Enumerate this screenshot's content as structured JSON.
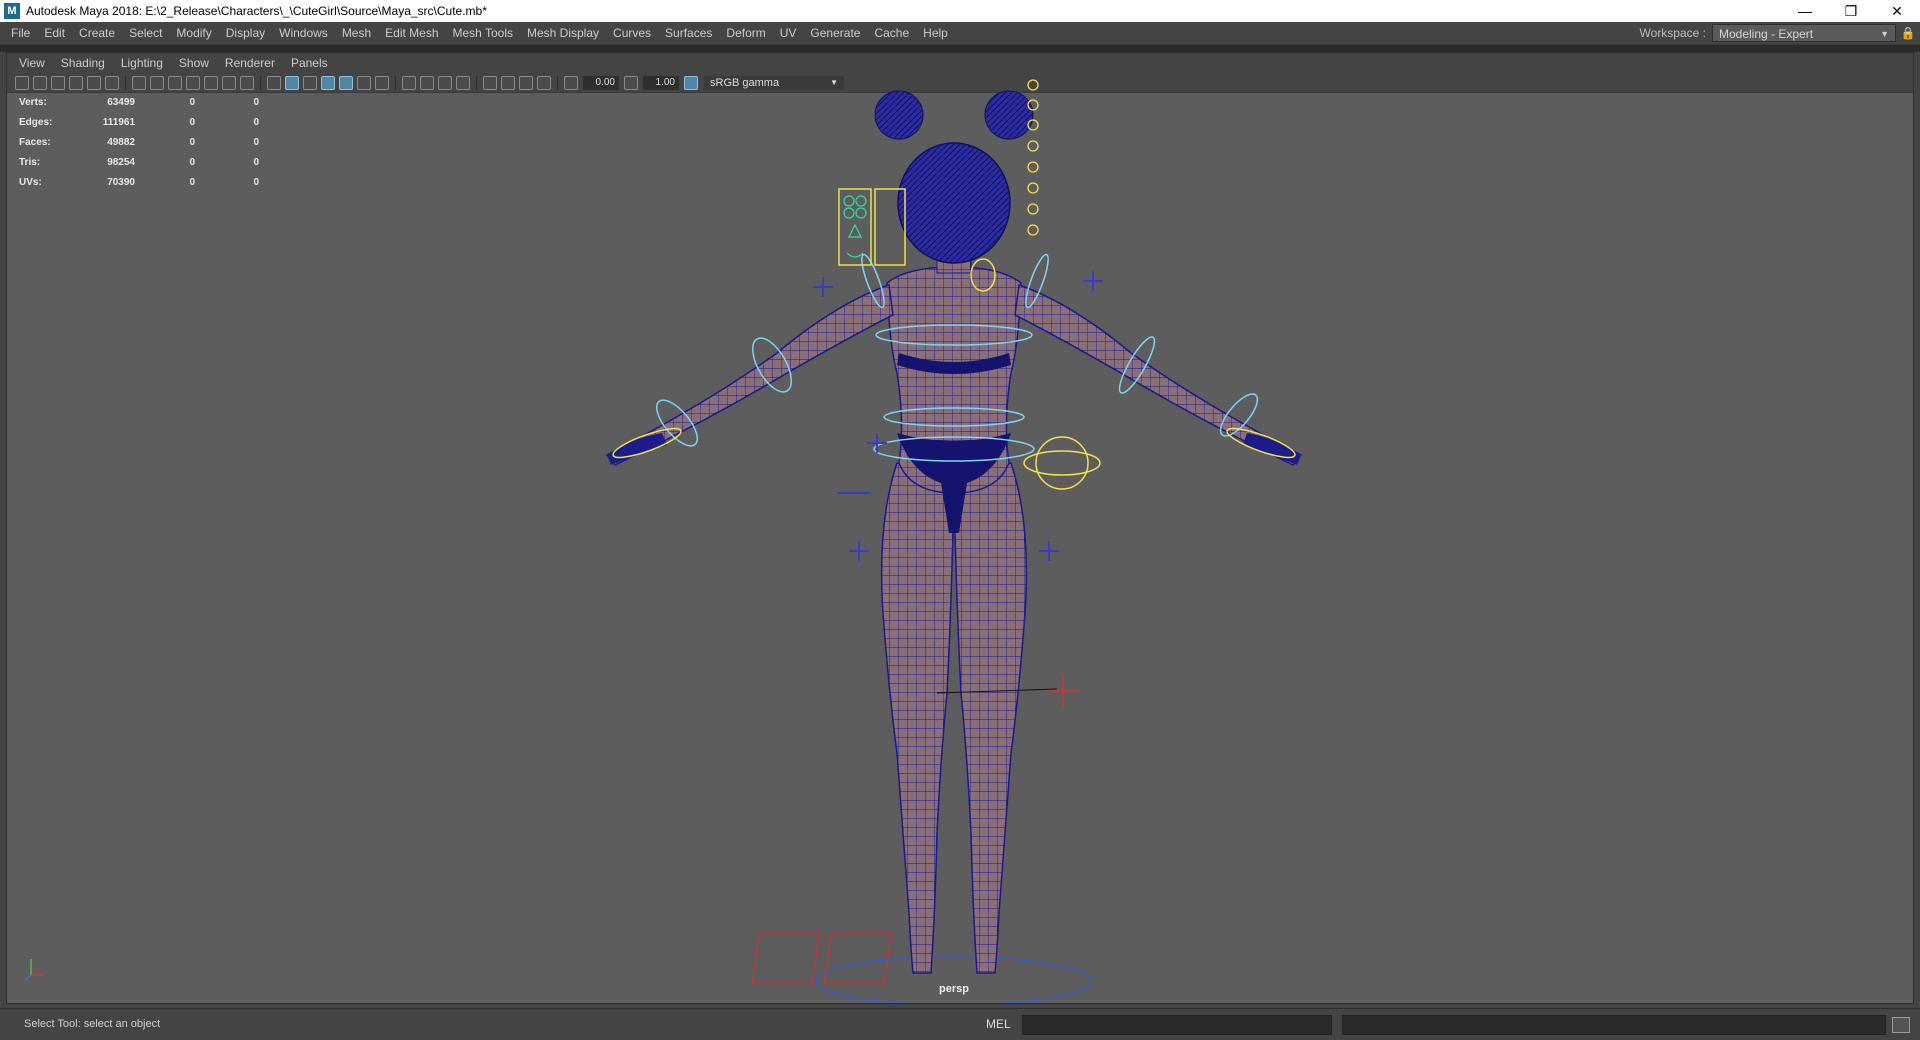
{
  "window": {
    "title": "Autodesk Maya 2018: E:\\2_Release\\Characters\\_\\CuteGirl\\Source\\Maya_src\\Cute.mb*",
    "logo": "M",
    "controls": [
      "—",
      "❐",
      "✕"
    ]
  },
  "menubar": {
    "items": [
      "File",
      "Edit",
      "Create",
      "Select",
      "Modify",
      "Display",
      "Windows",
      "Mesh",
      "Edit Mesh",
      "Mesh Tools",
      "Mesh Display",
      "Curves",
      "Surfaces",
      "Deform",
      "UV",
      "Generate",
      "Cache",
      "Help"
    ],
    "workspace_label": "Workspace :",
    "workspace_value": "Modeling - Expert"
  },
  "panel_menu": {
    "items": [
      "View",
      "Shading",
      "Lighting",
      "Show",
      "Renderer",
      "Panels"
    ]
  },
  "panel_toolbar": {
    "exposure": "0.00",
    "gamma": "1.00",
    "color_space": "sRGB gamma"
  },
  "hud": {
    "rows": [
      {
        "label": "Verts:",
        "v1": "63499",
        "v2": "0",
        "v3": "0"
      },
      {
        "label": "Edges:",
        "v1": "111961",
        "v2": "0",
        "v3": "0"
      },
      {
        "label": "Faces:",
        "v1": "49882",
        "v2": "0",
        "v3": "0"
      },
      {
        "label": "Tris:",
        "v1": "98254",
        "v2": "0",
        "v3": "0"
      },
      {
        "label": "UVs:",
        "v1": "70390",
        "v2": "0",
        "v3": "0"
      }
    ]
  },
  "viewport": {
    "camera_label": "persp",
    "mesh_color": "#8a6f78",
    "wire_color": "#1a1a8c",
    "control_color": "#7fd4f4",
    "selected_color": "#f0e24a"
  },
  "statusbar": {
    "help_text": "Select Tool: select an object",
    "mel_label": "MEL"
  }
}
